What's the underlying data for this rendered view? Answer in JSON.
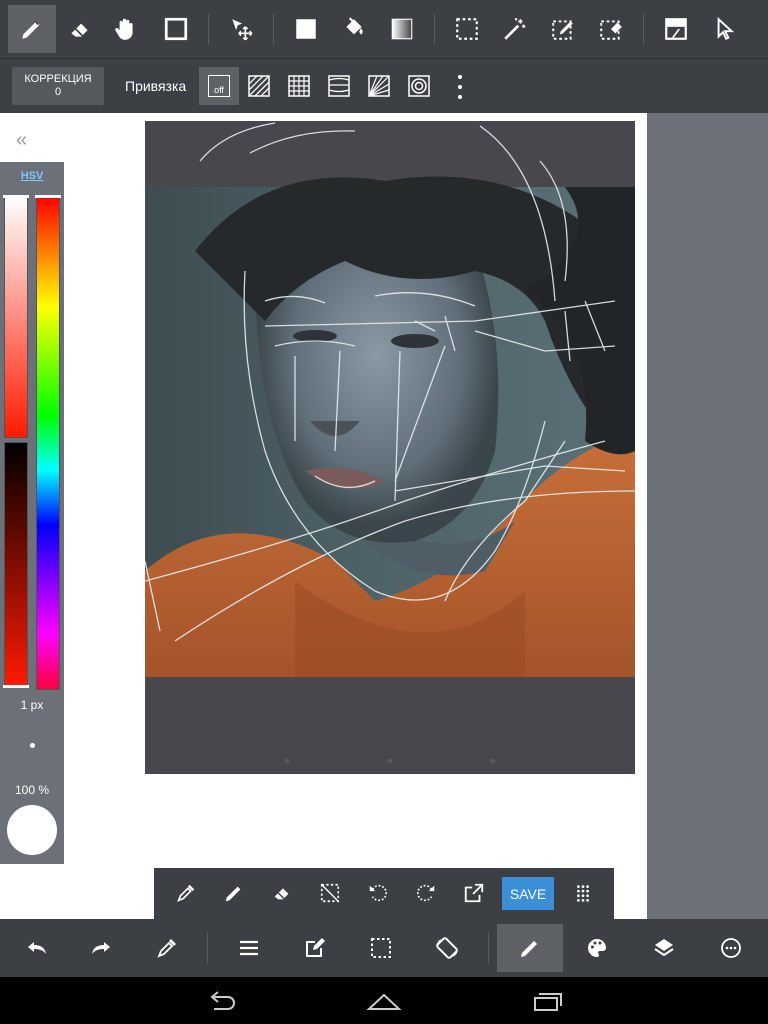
{
  "toolbar_top": {
    "tools": [
      {
        "icon": "pen-icon",
        "active": true
      },
      {
        "icon": "eraser-icon"
      },
      {
        "icon": "hand-icon"
      },
      {
        "icon": "rectangle-icon"
      },
      {
        "icon": "move-icon"
      },
      {
        "icon": "fill-square-icon"
      },
      {
        "icon": "bucket-icon"
      },
      {
        "icon": "gradient-icon"
      },
      {
        "icon": "select-rect-icon"
      },
      {
        "icon": "magic-wand-icon"
      },
      {
        "icon": "select-pen-icon"
      },
      {
        "icon": "select-eraser-icon"
      },
      {
        "icon": "layer-blend-icon"
      },
      {
        "icon": "pointer-icon"
      }
    ]
  },
  "snap_bar": {
    "correction_label": "КОРРЕКЦИЯ",
    "correction_value": "0",
    "snap_label": "Привязка",
    "snap_off_label": "off"
  },
  "color_panel": {
    "mode_label": "HSV",
    "brush_size": "1 px",
    "opacity": "100 %",
    "current_color": "#ffffff"
  },
  "float_bar": {
    "save_label": "SAVE"
  },
  "colors": {
    "toolbar_bg": "#3c3f43",
    "panel_bg": "#6c7079",
    "accent": "#3a8fd6",
    "canvas_bg": "#48474d"
  }
}
